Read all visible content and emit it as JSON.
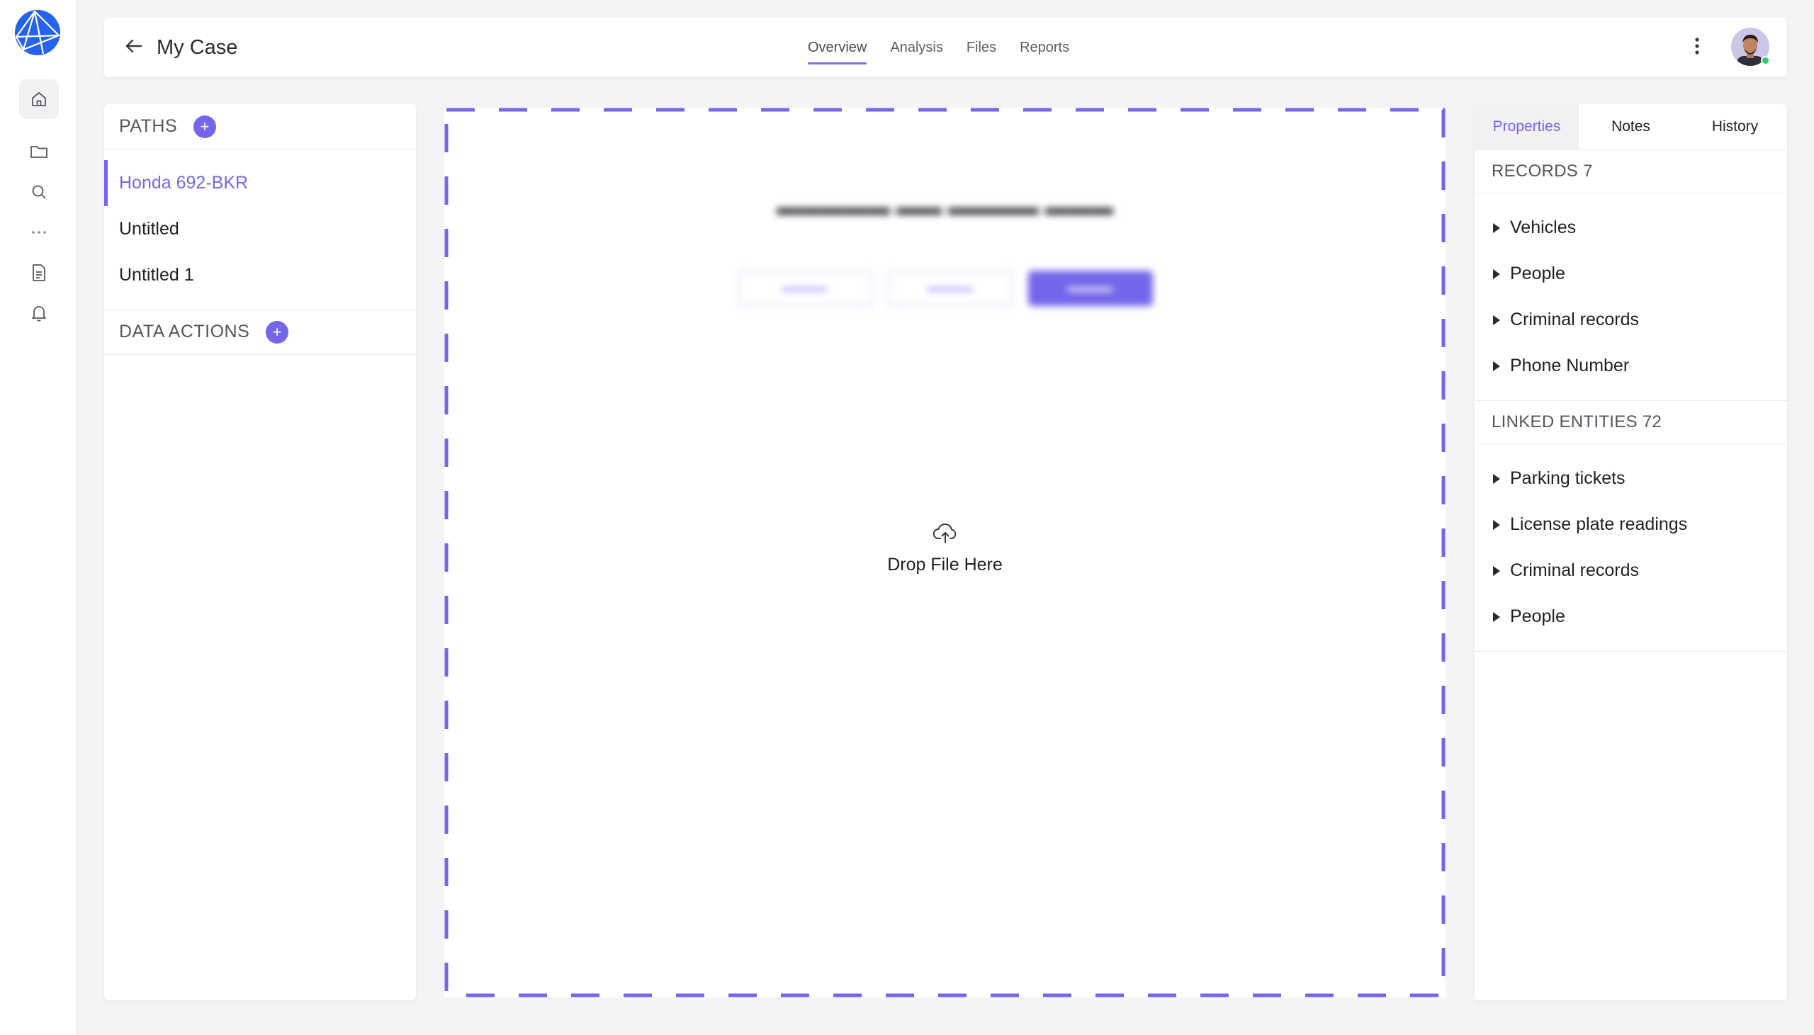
{
  "app": {
    "title": "My Case"
  },
  "header": {
    "tabs": [
      {
        "label": "Overview",
        "active": true
      },
      {
        "label": "Analysis",
        "active": false
      },
      {
        "label": "Files",
        "active": false
      },
      {
        "label": "Reports",
        "active": false
      }
    ]
  },
  "rail": {
    "items": [
      {
        "icon": "home-icon",
        "active": true
      },
      {
        "icon": "folder-icon",
        "active": false
      },
      {
        "icon": "search-icon",
        "active": false
      },
      {
        "icon": "more-horizontal-icon",
        "active": false
      },
      {
        "icon": "document-icon",
        "active": false
      },
      {
        "icon": "bell-icon",
        "active": false
      }
    ]
  },
  "paths": {
    "heading": "PATHS",
    "items": [
      {
        "label": "Honda 692-BKR",
        "active": true
      },
      {
        "label": "Untitled",
        "active": false
      },
      {
        "label": "Untitled 1",
        "active": false
      }
    ]
  },
  "data_actions": {
    "heading": "DATA ACTIONS"
  },
  "dropzone": {
    "label": "Drop File Here"
  },
  "right_panel": {
    "tabs": [
      {
        "label": "Properties",
        "active": true
      },
      {
        "label": "Notes",
        "active": false
      },
      {
        "label": "History",
        "active": false
      }
    ],
    "records": {
      "heading": "RECORDS 7",
      "items": [
        "Vehicles",
        "People",
        "Criminal records",
        "Phone Number"
      ]
    },
    "linked_entities": {
      "heading": "LINKED ENTITIES 72",
      "items": [
        "Parking tickets",
        "License plate readings",
        "Criminal records",
        "People"
      ]
    }
  },
  "colors": {
    "accent": "#7466ea",
    "presence": "#2ecc71",
    "logo": "#2563eb"
  }
}
